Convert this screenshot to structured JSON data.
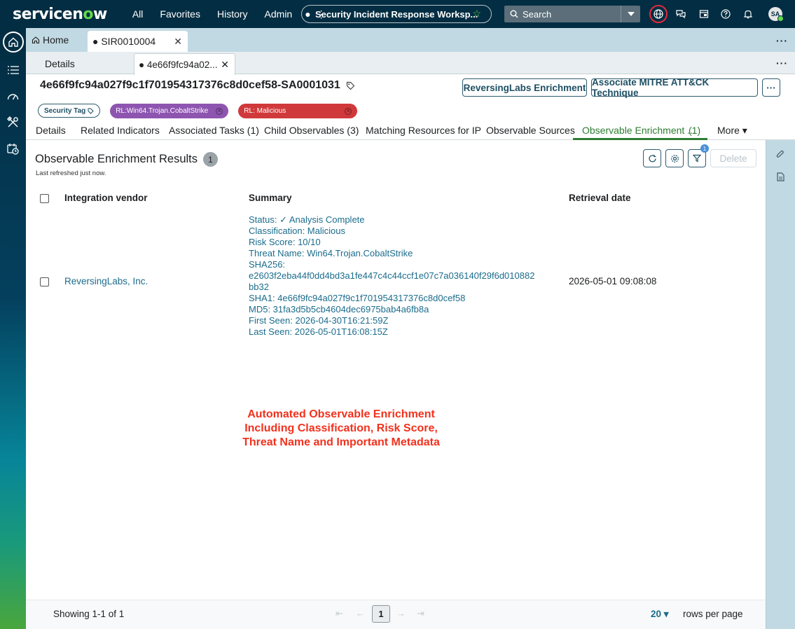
{
  "topbar": {
    "logo_prefix": "servicen",
    "logo_o": "o",
    "logo_suffix": "w",
    "nav": [
      "All",
      "Favorites",
      "History",
      "Admin"
    ],
    "more_dots": "● ⋮",
    "workspace": "Security Incident Response Worksp...",
    "search_label": "Search",
    "avatar_initials": "SA"
  },
  "tabs": {
    "home": "Home",
    "record": "● SIR0010004",
    "details": "Details",
    "observable": "● 4e66f9fc94a02..."
  },
  "record": {
    "title": "4e66f9fc94a027f9c1f701954317376c8d0cef58-SA0001031",
    "actions": {
      "reversinglabs": "ReversingLabs Enrichment",
      "mitre": "Associate MITRE ATT&CK Technique",
      "more": "···"
    },
    "security_tag": "Security Tag",
    "tags": [
      {
        "label": "RL:Win64.Trojan.CobaltStrike",
        "color": "#8e55b0"
      },
      {
        "label": "RL: Malicious",
        "color": "#d0393b"
      }
    ]
  },
  "subtabs": [
    "Details",
    "Related Indicators",
    "Associated Tasks (1)",
    "Child Observables (3)",
    "Matching Resources for IP",
    "Observable Sources",
    "Observable Enrichment ...",
    "(1)",
    "More ▾"
  ],
  "panel": {
    "title": "Observable Enrichment Results",
    "count": "1",
    "refreshed": "Last refreshed just now.",
    "filter_count": "1",
    "delete_label": "Delete",
    "columns": [
      "Integration vendor",
      "Summary",
      "Retrieval date"
    ],
    "rows": [
      {
        "vendor": "ReversingLabs, Inc.",
        "summary": [
          "Status: ✓ Analysis Complete",
          "Classification: Malicious",
          "Risk Score: 10/10",
          "Threat Name: Win64.Trojan.CobaltStrike",
          "SHA256:",
          "e2603f2eba44f0dd4bd3a1fe447c4c44ccf1e07c7a036140f29f6d010882",
          "bb32",
          "SHA1: 4e66f9fc94a027f9c1f701954317376c8d0cef58",
          "MD5: 31fa3d5b5cb4604dec6975bab4a6fb8a",
          "First Seen: 2026-04-30T16:21:59Z",
          "Last Seen: 2026-05-01T16:08:15Z"
        ],
        "retrieval_date": "2026-05-01 09:08:08"
      }
    ],
    "annotation": [
      "Automated Observable Enrichment",
      "Including Classification, Risk Score,",
      "Threat Name and Important Metadata"
    ],
    "footer": {
      "showing": "Showing 1-1 of 1",
      "page": "1",
      "rows_per_page_value": "20 ▾",
      "rows_per_page_label": "rows per page"
    }
  },
  "colors": {
    "nav_bg": "#032d42",
    "accent_green": "#2e7d32",
    "link": "#1b6c8c",
    "annotation_red": "#f2311d"
  }
}
